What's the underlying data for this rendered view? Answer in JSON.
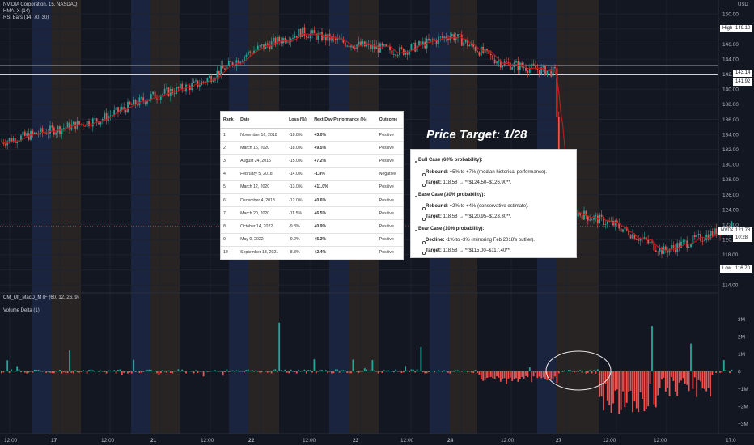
{
  "indicators": {
    "symbol_line": "NVIDIA Corporation, 15, NASDAQ",
    "hma": "HMA_X (14)",
    "rsi": "RSI Bars (14, 70, 30)",
    "macd": "CM_Ult_MacD_MTF (60, 12, 26, 9)",
    "volume_delta": "Volume Delta (1)"
  },
  "price_axis": {
    "currency": "USD",
    "ticks": [
      "150.00",
      "148.00",
      "146.00",
      "144.00",
      "142.00",
      "140.00",
      "138.00",
      "136.00",
      "134.00",
      "132.00",
      "130.00",
      "128.00",
      "126.00",
      "124.00",
      "122.00",
      "120.00",
      "118.00",
      "116.00",
      "114.00"
    ],
    "high_label": "High",
    "high_value": "149.10",
    "level1": "143.14",
    "level2": "141.92",
    "nvda_label": "NVDA",
    "nvda_price": "121.78",
    "nvda_time": "10:28",
    "low_label": "Low",
    "low_value": "116.70"
  },
  "volume_axis": {
    "ticks": [
      "3M",
      "2M",
      "1M",
      "0",
      "−1M",
      "−2M",
      "−3M"
    ]
  },
  "time_axis": [
    "12:00",
    "17",
    "12:00",
    "21",
    "12:00",
    "22",
    "12:00",
    "23",
    "12:00",
    "24",
    "12:00",
    "27",
    "12:00",
    "12:00",
    "17:0"
  ],
  "history_table": {
    "headers": [
      "Rank",
      "Date",
      "Loss (%)",
      "Next-Day Performance (%)",
      "Outcome"
    ],
    "rows": [
      [
        "1",
        "November 16, 2018",
        "-18.8%",
        "+3.0%",
        "Positive"
      ],
      [
        "2",
        "March 16, 2020",
        "-18.0%",
        "+9.5%",
        "Positive"
      ],
      [
        "3",
        "August 24, 2015",
        "-15.0%",
        "+7.2%",
        "Positive"
      ],
      [
        "4",
        "February 5, 2018",
        "-14.0%",
        "-1.8%",
        "Negative"
      ],
      [
        "5",
        "March 12, 2020",
        "-13.0%",
        "+11.0%",
        "Positive"
      ],
      [
        "6",
        "December 4, 2018",
        "-12.0%",
        "+0.6%",
        "Positive"
      ],
      [
        "7",
        "March 20, 2020",
        "-11.5%",
        "+6.5%",
        "Positive"
      ],
      [
        "8",
        "October 14, 2022",
        "-9.3%",
        "+0.9%",
        "Positive"
      ],
      [
        "9",
        "May 9, 2022",
        "-9.2%",
        "+5.3%",
        "Positive"
      ],
      [
        "10",
        "September 13, 2021",
        "-8.3%",
        "+2.4%",
        "Positive"
      ]
    ]
  },
  "price_target": {
    "title": "Price Target: 1/28",
    "bull_heading": "Bull Case (60% probability):",
    "bull_rebound_label": "Rebound:",
    "bull_rebound_text": " +5% to +7% (median historical performance).",
    "bull_target_label": "Target:",
    "bull_target_text": " 118.58 → **$124.50–$126.90**.",
    "base_heading": "Base Case (30% probability):",
    "base_rebound_label": "Rebound:",
    "base_rebound_text": " +2% to +4% (conservative estimate).",
    "base_target_label": "Target:",
    "base_target_text": " 118.58 → **$120.95–$123.30**.",
    "bear_heading": "Bear Case (10% probability):",
    "bear_decline_label": "Decline:",
    "bear_decline_text": " -1% to -3% (mirroring Feb 2018’s outlier).",
    "bear_target_label": "Target:",
    "bear_target_text": " 118.58 → **$115.00–$117.40**."
  },
  "colors": {
    "background": "#131722",
    "up": "#26a69a",
    "down": "#ef5350",
    "hma": "#b71c1c",
    "session_blue": "#1e2a4a",
    "session_brown": "#2f2a24"
  },
  "chart_data": {
    "type": "candlestick",
    "interval": "15",
    "price_range": [
      113,
      151
    ],
    "volume_delta_range": [
      -3.3,
      3.3
    ],
    "price_path": [
      {
        "x": "16 12:00",
        "y": 133.0
      },
      {
        "x": "17",
        "y": 134.5
      },
      {
        "x": "17 12:00",
        "y": 136.0
      },
      {
        "x": "21",
        "y": 139.0
      },
      {
        "x": "21 12:00",
        "y": 140.8
      },
      {
        "x": "22",
        "y": 145.0
      },
      {
        "x": "22 12:00",
        "y": 147.6
      },
      {
        "x": "23",
        "y": 146.0
      },
      {
        "x": "23 12:00",
        "y": 145.0
      },
      {
        "x": "24",
        "y": 147.2
      },
      {
        "x": "24 12:00",
        "y": 143.5
      },
      {
        "x": "27 open",
        "y": 142.2
      },
      {
        "x": "27",
        "y": 124.0
      },
      {
        "x": "27 12:00",
        "y": 122.0
      },
      {
        "x": "28 12:00",
        "y": 118.5
      },
      {
        "x": "28 17:00",
        "y": 121.78
      }
    ],
    "high": 149.1,
    "low": 116.7,
    "last": 121.78,
    "horizontal_levels": [
      143.14,
      141.92
    ]
  }
}
